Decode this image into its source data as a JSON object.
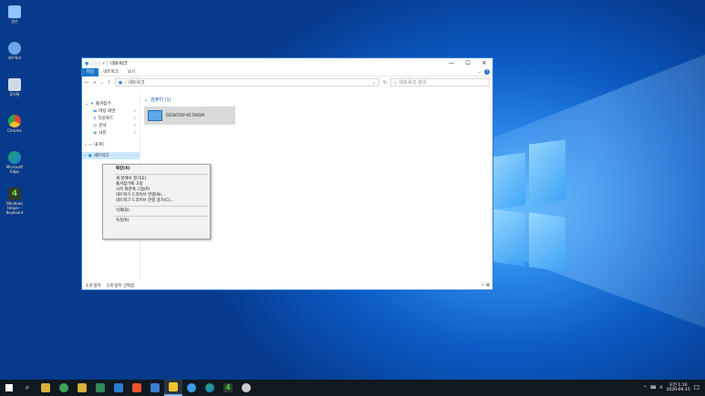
{
  "desktop": {
    "icons": [
      {
        "label": "정은",
        "icon": "user-folder-icon",
        "color": "#8fc3ff"
      },
      {
        "label": "네트워크",
        "icon": "network-icon",
        "color": "#6aa8e8"
      },
      {
        "label": "휴지통",
        "icon": "recycle-bin-icon",
        "color": "#d0dbe6"
      },
      {
        "label": "Chrome",
        "icon": "chrome-icon",
        "color": "#e34133"
      },
      {
        "label": "Microsoft Edge",
        "icon": "edge-icon",
        "color": "#1fa365"
      },
      {
        "label": "Windows Helper - Keyboard",
        "icon": "app-4-icon",
        "color": "#2f3a2a"
      }
    ]
  },
  "explorer": {
    "title": "네트워크",
    "controls": {
      "minimize": "—",
      "maximize": "☐",
      "close": "✕"
    },
    "ribbon_tabs": [
      "파일",
      "네트워크",
      "보기"
    ],
    "address": "네트워크",
    "search_placeholder": "네트워크 검색",
    "nav": {
      "quick_access": "즐겨찾기",
      "items": [
        "바탕 화면",
        "다운로드",
        "문서",
        "사진"
      ],
      "this_pc": "내 PC",
      "network": "네트워크"
    },
    "group_header": "컴퓨터 (1)",
    "computer_name": "DESKTOP-917KISM",
    "status": {
      "count": "1개 항목",
      "selected": "1개 항목 선택함"
    }
  },
  "context_menu": {
    "items": [
      "확장(X)",
      "새 창에서 열기(E)",
      "즐겨찾기에 고정",
      "시작 화면에 고정(P)",
      "네트워크 드라이브 연결(N)...",
      "네트워크 드라이브 연결 끊기(C)...",
      "삭제(D)",
      "속성(R)"
    ]
  },
  "taskbar": {
    "apps": [
      {
        "name": "start-button",
        "color": "#ffffff"
      },
      {
        "name": "search-icon",
        "color": "#ffffff"
      },
      {
        "name": "app-icon",
        "color": "#d8b23a"
      },
      {
        "name": "app-icon",
        "color": "#3ea65b"
      },
      {
        "name": "app-icon",
        "color": "#d7b03a"
      },
      {
        "name": "app-icon",
        "color": "#2e8b57"
      },
      {
        "name": "app-icon",
        "color": "#2b7bd6"
      },
      {
        "name": "app-icon",
        "color": "#e8542c"
      },
      {
        "name": "app-icon",
        "color": "#3a7fd0"
      },
      {
        "name": "file-explorer-icon",
        "color": "#f2c230"
      },
      {
        "name": "edge-legacy-icon",
        "color": "#3a9bea"
      },
      {
        "name": "edge-icon",
        "color": "#25a36a"
      },
      {
        "name": "app-4-icon",
        "color": "#4fc34a"
      },
      {
        "name": "app-icon",
        "color": "#cccccc"
      }
    ],
    "ime": "A",
    "time": "오전 1:10",
    "date": "2020-09-15"
  }
}
